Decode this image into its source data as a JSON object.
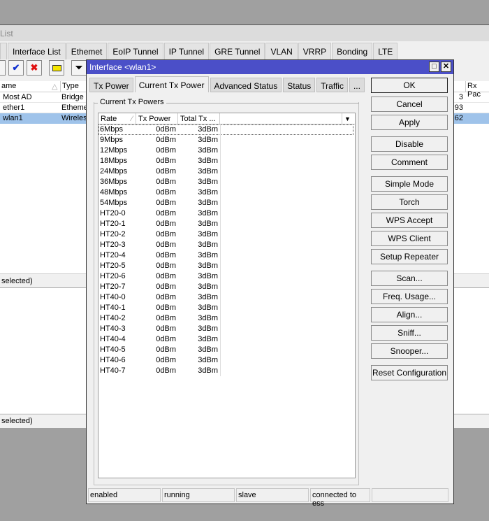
{
  "background_window": {
    "title": "List",
    "tabs": [
      "Interface List",
      "Ethemet",
      "EoIP Tunnel",
      "IP Tunnel",
      "GRE Tunnel",
      "VLAN",
      "VRRP",
      "Bonding",
      "LTE"
    ],
    "columns": [
      "ame",
      "Type",
      "Rx Pac"
    ],
    "rows": [
      {
        "name": "Most AD",
        "type": "Bridge",
        "rx": "3"
      },
      {
        "name": "ether1",
        "type": "Etheme",
        "rx": "93"
      },
      {
        "name": "wlan1",
        "type": "Wireles",
        "rx": "62"
      }
    ],
    "status_top": "selected)",
    "status_bottom": "selected)"
  },
  "dialog": {
    "title": "Interface <wlan1>",
    "tabs": [
      "Tx Power",
      "Current Tx Power",
      "Advanced Status",
      "Status",
      "Traffic",
      "..."
    ],
    "active_tab": "Current Tx Power",
    "group_label": "Current Tx Powers",
    "table": {
      "columns": [
        "Rate",
        "Tx Power",
        "Total Tx ..."
      ],
      "rows": [
        [
          "6Mbps",
          "0dBm",
          "3dBm"
        ],
        [
          "9Mbps",
          "0dBm",
          "3dBm"
        ],
        [
          "12Mbps",
          "0dBm",
          "3dBm"
        ],
        [
          "18Mbps",
          "0dBm",
          "3dBm"
        ],
        [
          "24Mbps",
          "0dBm",
          "3dBm"
        ],
        [
          "36Mbps",
          "0dBm",
          "3dBm"
        ],
        [
          "48Mbps",
          "0dBm",
          "3dBm"
        ],
        [
          "54Mbps",
          "0dBm",
          "3dBm"
        ],
        [
          "HT20-0",
          "0dBm",
          "3dBm"
        ],
        [
          "HT20-1",
          "0dBm",
          "3dBm"
        ],
        [
          "HT20-2",
          "0dBm",
          "3dBm"
        ],
        [
          "HT20-3",
          "0dBm",
          "3dBm"
        ],
        [
          "HT20-4",
          "0dBm",
          "3dBm"
        ],
        [
          "HT20-5",
          "0dBm",
          "3dBm"
        ],
        [
          "HT20-6",
          "0dBm",
          "3dBm"
        ],
        [
          "HT20-7",
          "0dBm",
          "3dBm"
        ],
        [
          "HT40-0",
          "0dBm",
          "3dBm"
        ],
        [
          "HT40-1",
          "0dBm",
          "3dBm"
        ],
        [
          "HT40-2",
          "0dBm",
          "3dBm"
        ],
        [
          "HT40-3",
          "0dBm",
          "3dBm"
        ],
        [
          "HT40-4",
          "0dBm",
          "3dBm"
        ],
        [
          "HT40-5",
          "0dBm",
          "3dBm"
        ],
        [
          "HT40-6",
          "0dBm",
          "3dBm"
        ],
        [
          "HT40-7",
          "0dBm",
          "3dBm"
        ]
      ]
    },
    "buttons": [
      "OK",
      "Cancel",
      "Apply",
      "Disable",
      "Comment",
      "Simple Mode",
      "Torch",
      "WPS Accept",
      "WPS Client",
      "Setup Repeater",
      "Scan...",
      "Freq. Usage...",
      "Align...",
      "Sniff...",
      "Snooper...",
      "Reset Configuration"
    ],
    "status_bar": [
      "enabled",
      "running",
      "slave",
      "connected to ess",
      ""
    ]
  },
  "colors": {
    "title_bar": "#4b4fc8",
    "selection": "#9fc3ea"
  }
}
